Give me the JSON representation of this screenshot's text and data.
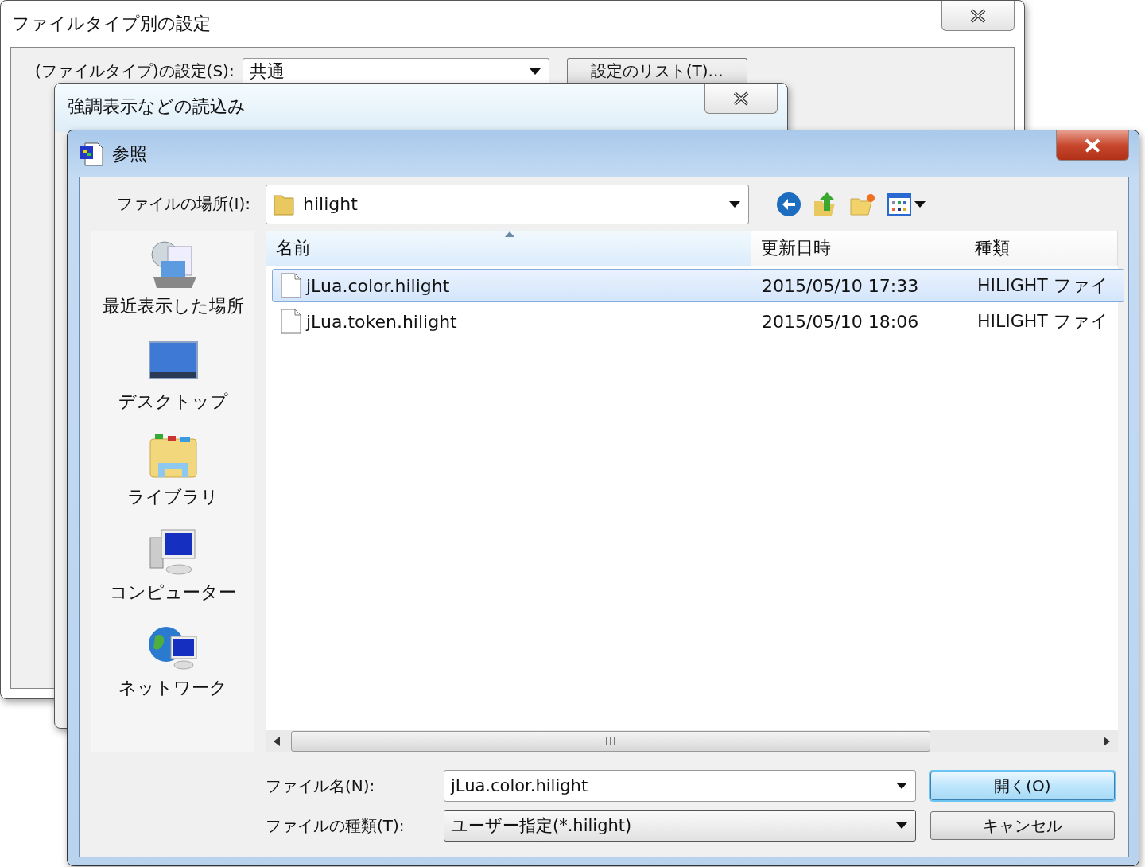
{
  "settings_window": {
    "title": "ファイルタイプ別の設定",
    "filetype_label": "(ファイルタイプ)の設定(S):",
    "filetype_value": "共通",
    "list_button": "設定のリスト(T)..."
  },
  "import_window": {
    "title": "強調表示などの読込み"
  },
  "browse_dialog": {
    "title": "参照",
    "location": {
      "label": "ファイルの場所(I):",
      "value": "hilight"
    },
    "places": [
      {
        "label": "最近表示した場所",
        "kind": "recent"
      },
      {
        "label": "デスクトップ",
        "kind": "desktop"
      },
      {
        "label": "ライブラリ",
        "kind": "library"
      },
      {
        "label": "コンピューター",
        "kind": "computer"
      },
      {
        "label": "ネットワーク",
        "kind": "network"
      }
    ],
    "columns": [
      "名前",
      "更新日時",
      "種類"
    ],
    "rows": [
      {
        "name": "jLua.color.hilight",
        "modified": "2015/05/10 17:33",
        "type": "HILIGHT ファイ",
        "selected": true
      },
      {
        "name": "jLua.token.hilight",
        "modified": "2015/05/10 18:06",
        "type": "HILIGHT ファイ",
        "selected": false
      }
    ],
    "filename": {
      "label": "ファイル名(N):",
      "value": "jLua.color.hilight"
    },
    "filetype": {
      "label": "ファイルの種類(T):",
      "value": "ユーザー指定(*.hilight)"
    },
    "buttons": [
      {
        "label": "開く(O)",
        "default": true
      },
      {
        "label": "キャンセル",
        "default": false
      }
    ]
  }
}
